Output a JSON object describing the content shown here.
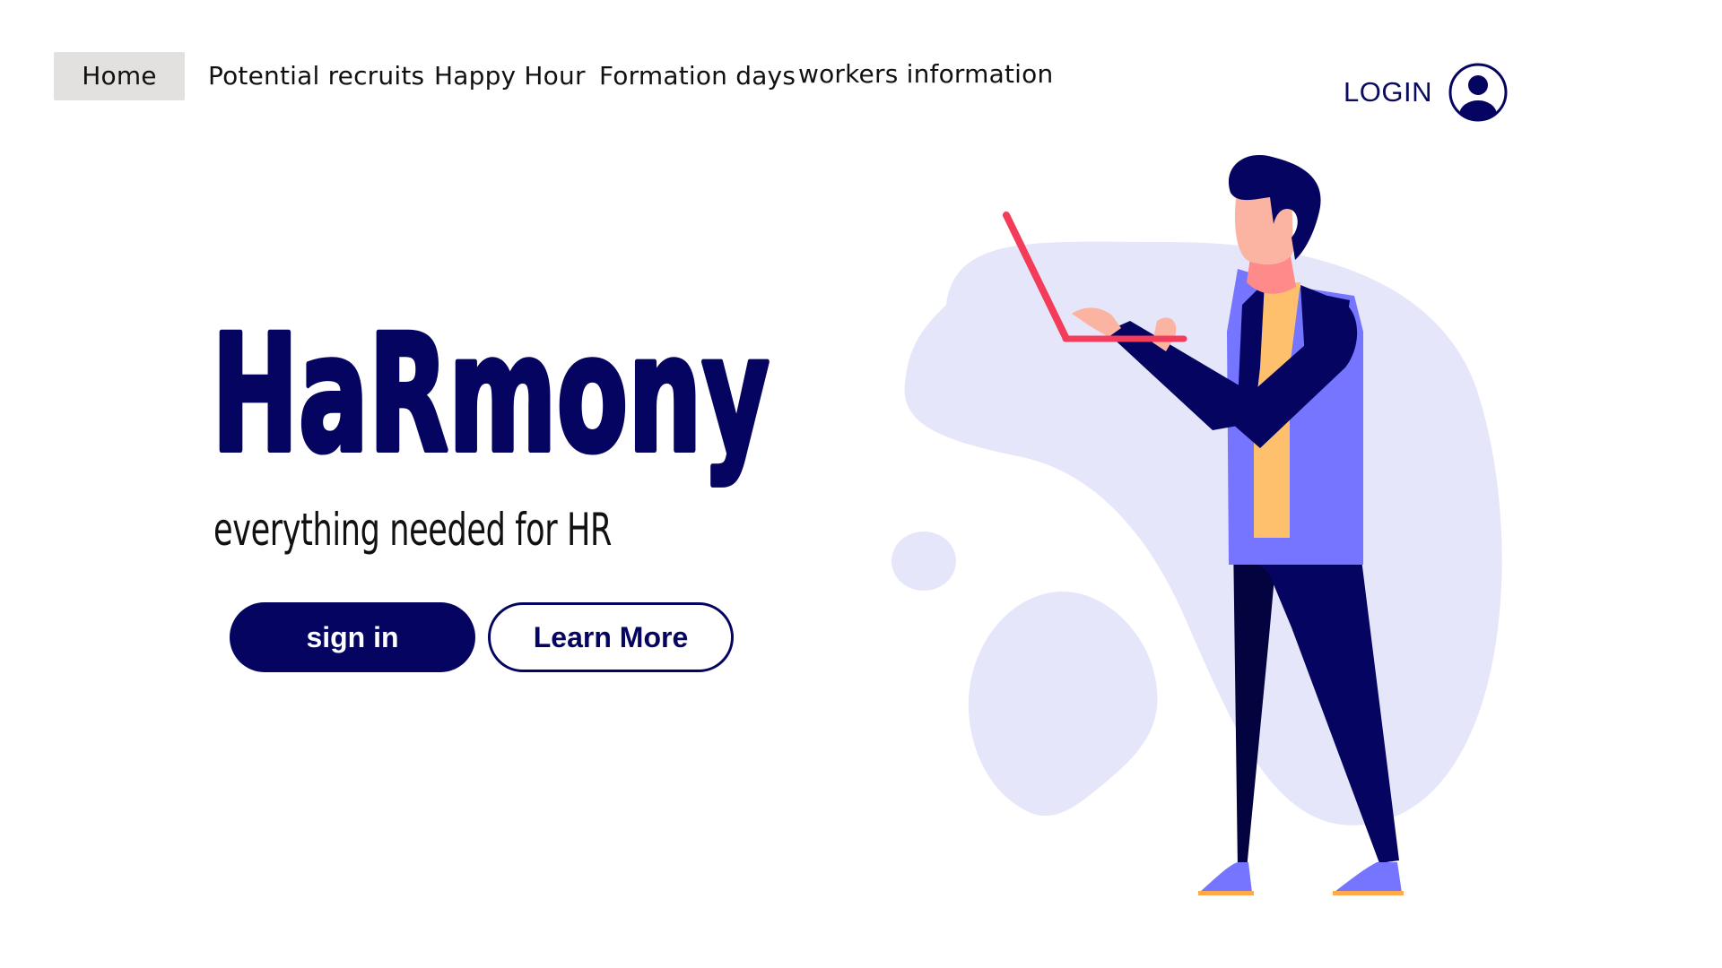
{
  "nav": {
    "items": [
      {
        "label": "Home",
        "active": true
      },
      {
        "label": "Potential recruits",
        "active": false
      },
      {
        "label": "Happy Hour",
        "active": false
      },
      {
        "label": "Formation days",
        "active": false
      },
      {
        "label": "workers information",
        "active": false
      }
    ]
  },
  "login": {
    "label": "LOGIN",
    "icon": "user-circle-icon"
  },
  "hero": {
    "title": "HaRmony",
    "tagline": "everything needed for HR"
  },
  "buttons": {
    "primary_label": "sign in",
    "secondary_label": "Learn More"
  },
  "colors": {
    "navy": "#050561",
    "accent_purple": "#7575ff",
    "blob": "#e6e6fb",
    "laptop_red": "#f23c5a",
    "shirt_yellow": "#ffc06e",
    "skin": "#fbb3a2",
    "nav_active_bg": "#e3e1df"
  }
}
